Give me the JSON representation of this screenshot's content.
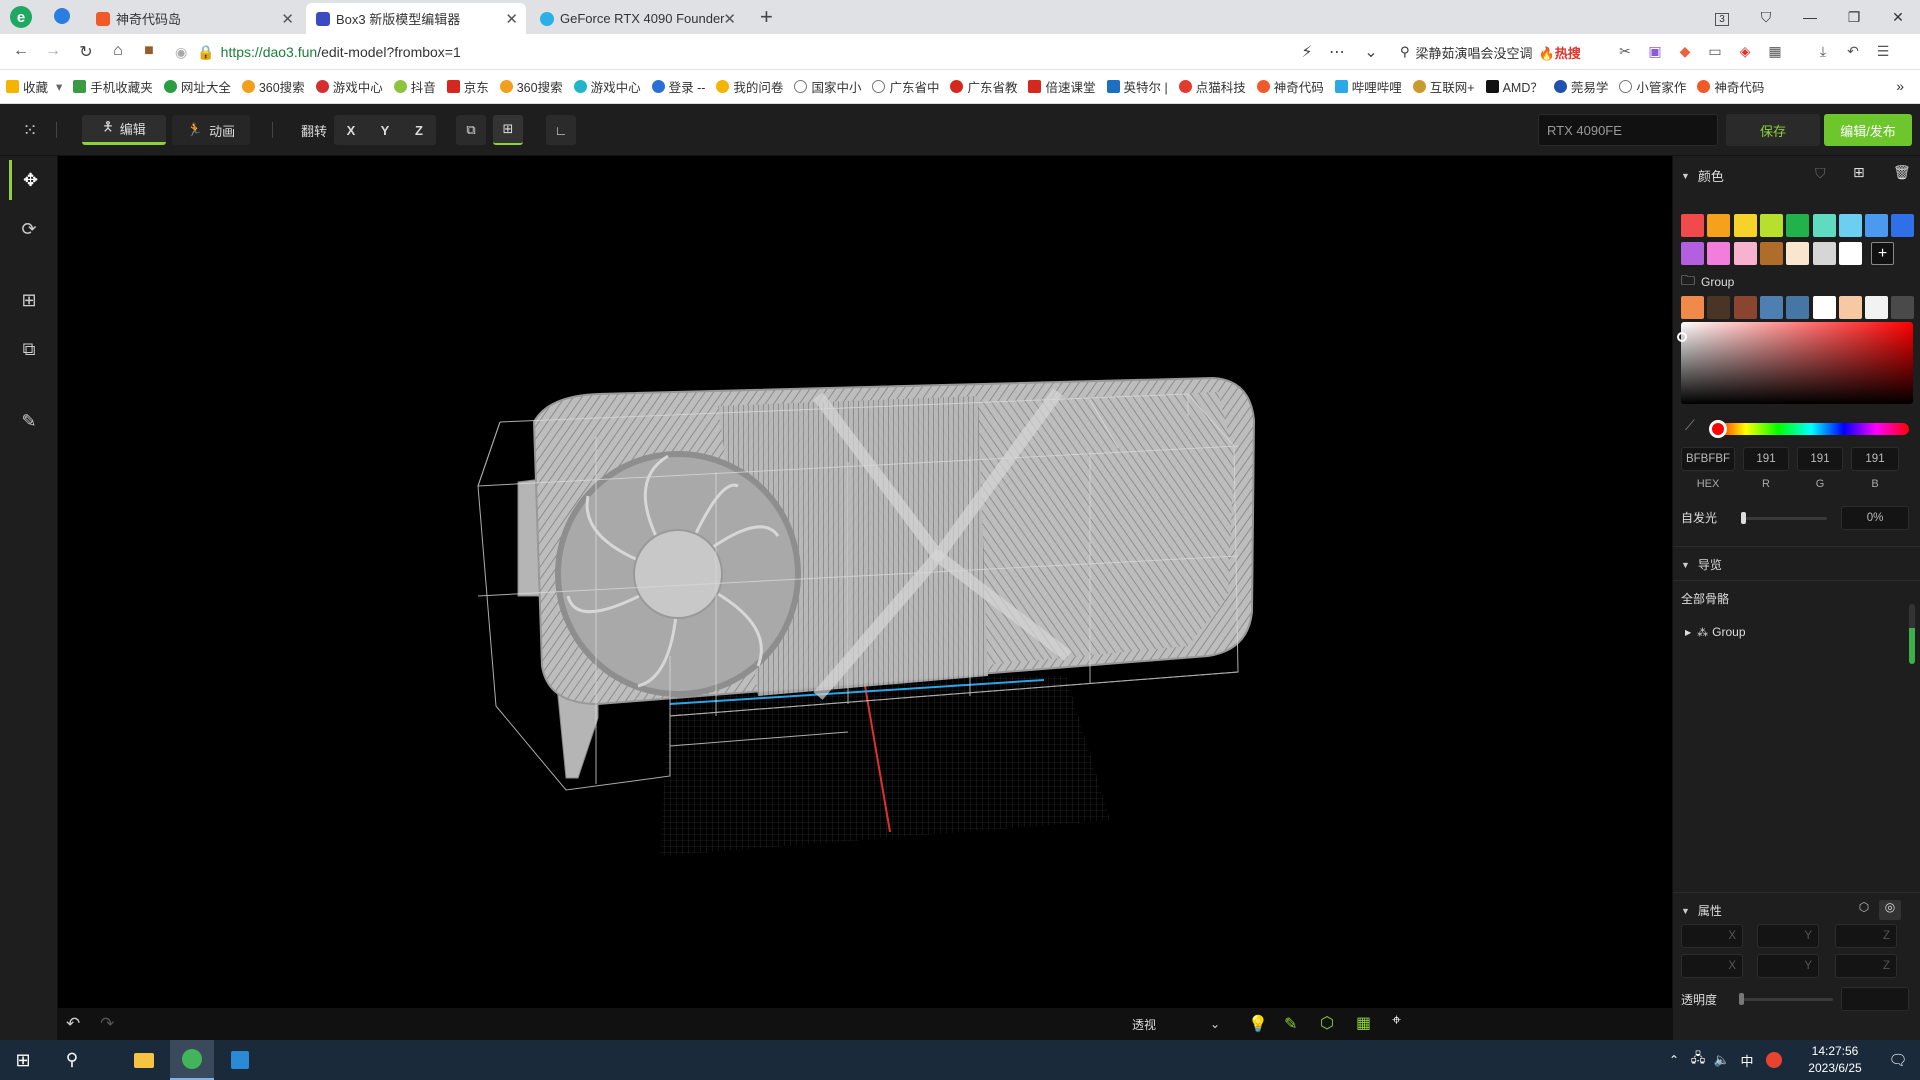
{
  "browser": {
    "tabs": [
      {
        "title": "神奇代码岛",
        "active": false
      },
      {
        "title": "Box3 新版模型编辑器",
        "active": true
      },
      {
        "title": "GeForce RTX 4090 Founder",
        "active": false
      }
    ],
    "tab_counter": "3",
    "url_scheme": "https://",
    "url_host": "dao3.fun",
    "url_path": "/edit-model?frombox=1",
    "search_text": "梁静茹演唱会没空调",
    "search_hot": "🔥热搜",
    "bookmarks": [
      "收藏",
      "手机收藏夹",
      "网址大全",
      "360搜索",
      "游戏中心",
      "抖音",
      "京东",
      "360搜索",
      "游戏中心",
      "登录 --",
      "我的问卷",
      "国家中小",
      "广东省中",
      "广东省教",
      "倍速课堂",
      "英特尔 |",
      "点猫科技",
      "神奇代码",
      "哔哩哔哩",
      "互联网+",
      "AMD？",
      "莞易学",
      "小管家作",
      "神奇代码"
    ],
    "bookmarks_more": "»"
  },
  "app": {
    "mode_edit": "编辑",
    "mode_anim": "动画",
    "flip_label": "翻转",
    "axes": [
      "X",
      "Y",
      "Z"
    ],
    "model_name": "RTX 4090FE",
    "save": "保存",
    "publish": "编辑/发布",
    "colors_section": "颜色",
    "group_label": "Group",
    "palette_row1": [
      "#f04a4a",
      "#f5a11c",
      "#f6d32a",
      "#b6e02b",
      "#22b24c",
      "#5fdcc0",
      "#6ccff2",
      "#4a9af2",
      "#2f6fe8"
    ],
    "palette_row2": [
      "#b25fe0",
      "#f27ddc",
      "#f7b2cf",
      "#b06d2a",
      "#f8e6cf",
      "#d6d6d6",
      "#ffffff"
    ],
    "group_colors": [
      "#f08a4b",
      "#4a3426",
      "#8a4530",
      "#4d7fb2",
      "#4676a6",
      "#ffffff",
      "#f6c9a3",
      "#f2f2f2",
      "#4a4a4a"
    ],
    "hex": "BFBFBF",
    "r": "191",
    "g": "191",
    "b": "191",
    "hex_label": "HEX",
    "r_label": "R",
    "g_label": "G",
    "b_label": "B",
    "emissive_label": "自发光",
    "emissive_value": "0%",
    "navigator_section": "导览",
    "all_bones": "全部骨骼",
    "tree_group": "Group",
    "props_section": "属性",
    "pos_labels": [
      "X",
      "Y",
      "Z"
    ],
    "rot_labels": [
      "X",
      "Y",
      "Z"
    ],
    "opacity_label": "透明度",
    "view_mode": "透视"
  },
  "taskbar": {
    "time": "14:27:56",
    "date": "2023/6/25",
    "ime": "中"
  }
}
